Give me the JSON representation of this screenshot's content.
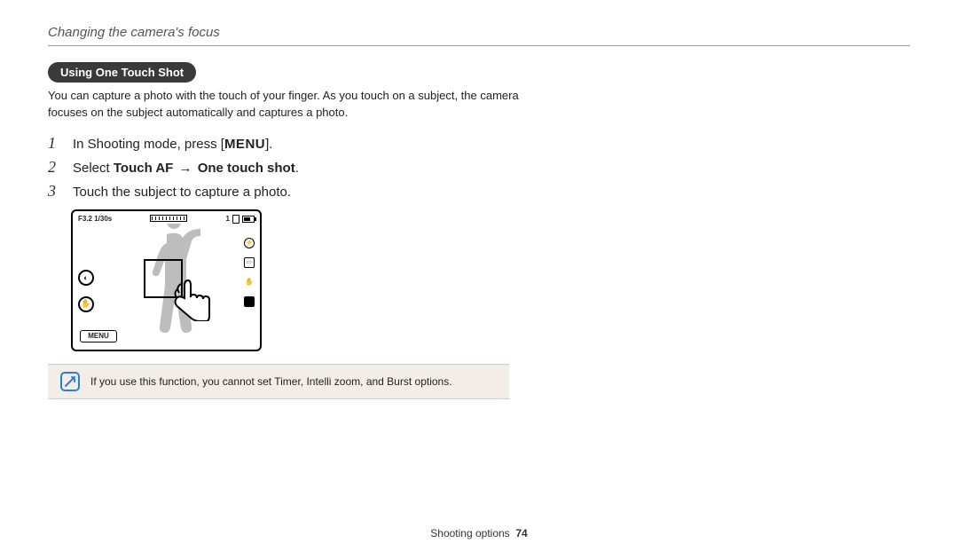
{
  "section_title": "Changing the camera's focus",
  "pill": "Using One Touch Shot",
  "intro": "You can capture a photo with the touch of your finger. As you touch on a subject, the camera focuses on the subject automatically and captures a photo.",
  "steps": {
    "s1_a": "In Shooting mode, press [",
    "s1_menu": "MENU",
    "s1_b": "].",
    "s2_a": "Select ",
    "s2_b": "Touch AF",
    "s2_arrow": "→",
    "s2_c": "One touch shot",
    "s2_d": ".",
    "s3": "Touch the subject to capture a photo."
  },
  "camera": {
    "exposure": "F3.2 1/30s",
    "count": "1",
    "menu_label": "MENU"
  },
  "note_text": "If you use this function, you cannot set Timer, Intelli zoom, and Burst options.",
  "footer_label": "Shooting options",
  "page_number": "74"
}
